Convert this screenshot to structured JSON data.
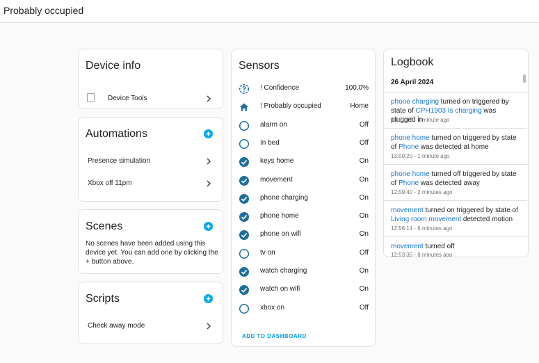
{
  "header": {
    "title": "Probably occupied"
  },
  "device_info": {
    "title": "Device info",
    "items": [
      {
        "label": "Device Tools",
        "icon": "device-tools-image"
      }
    ]
  },
  "automations": {
    "title": "Automations",
    "items": [
      {
        "label": "Presence simulation"
      },
      {
        "label": "Xbox off 11pm"
      }
    ]
  },
  "scenes": {
    "title": "Scenes",
    "description": "No scenes have been added using this device yet. You can add one by clicking the + button above."
  },
  "scripts": {
    "title": "Scripts",
    "items": [
      {
        "label": "Check away mode"
      }
    ]
  },
  "sensors": {
    "title": "Sensors",
    "add_label": "ADD TO DASHBOARD",
    "rows": [
      {
        "icon": "help-circle-outline-icon",
        "name": "! Confidence",
        "state": "100.0%"
      },
      {
        "icon": "home-icon",
        "name": "! Probably occupied",
        "state": "Home"
      },
      {
        "icon": "circle-outline-icon",
        "name": "alarm on",
        "state": "Off"
      },
      {
        "icon": "circle-outline-icon",
        "name": "In bed",
        "state": "Off"
      },
      {
        "icon": "check-circle-icon",
        "name": "keys home",
        "state": "On"
      },
      {
        "icon": "check-circle-icon",
        "name": "movement",
        "state": "On"
      },
      {
        "icon": "check-circle-icon",
        "name": "phone charging",
        "state": "On"
      },
      {
        "icon": "check-circle-icon",
        "name": "phone home",
        "state": "On"
      },
      {
        "icon": "check-circle-icon",
        "name": "phone on wifi",
        "state": "On"
      },
      {
        "icon": "circle-outline-icon",
        "name": "tv on",
        "state": "Off"
      },
      {
        "icon": "check-circle-icon",
        "name": "watch charging",
        "state": "On"
      },
      {
        "icon": "check-circle-icon",
        "name": "watch on wifi",
        "state": "On"
      },
      {
        "icon": "circle-outline-icon",
        "name": "xbox on",
        "state": "Off"
      }
    ]
  },
  "logbook": {
    "title": "Logbook",
    "date": "26 April 2024",
    "entries": [
      {
        "parts": [
          {
            "text": "phone charging",
            "link": true
          },
          {
            "text": " turned on triggered by state of ",
            "link": false
          },
          {
            "text": "CPH1903 Is charging",
            "link": true
          },
          {
            "text": " was plugged in",
            "link": false
          }
        ],
        "time": "13:01:10 - 1 minute ago"
      },
      {
        "parts": [
          {
            "text": "phone home",
            "link": true
          },
          {
            "text": " turned on triggered by state of ",
            "link": false
          },
          {
            "text": "Phone",
            "link": true
          },
          {
            "text": " was detected at home",
            "link": false
          }
        ],
        "time": "13:00:20 - 1 minute ago"
      },
      {
        "parts": [
          {
            "text": "phone home",
            "link": true
          },
          {
            "text": " turned off triggered by state of ",
            "link": false
          },
          {
            "text": "Phone",
            "link": true
          },
          {
            "text": " was detected away",
            "link": false
          }
        ],
        "time": "12:59:40 - 2 minutes ago"
      },
      {
        "parts": [
          {
            "text": "movement",
            "link": true
          },
          {
            "text": " turned on triggered by state of ",
            "link": false
          },
          {
            "text": "Living room movement",
            "link": true
          },
          {
            "text": " detected motion",
            "link": false
          }
        ],
        "time": "12:56:14 - 6 minutes ago"
      },
      {
        "parts": [
          {
            "text": "movement",
            "link": true
          },
          {
            "text": " turned off",
            "link": false
          }
        ],
        "time": "12:53:35 - 8 minutes ago"
      }
    ]
  },
  "colors": {
    "accent": "#03a9f4",
    "icon": "#1f6f9b",
    "link": "#1976d2",
    "secondary_text": "#727272"
  }
}
